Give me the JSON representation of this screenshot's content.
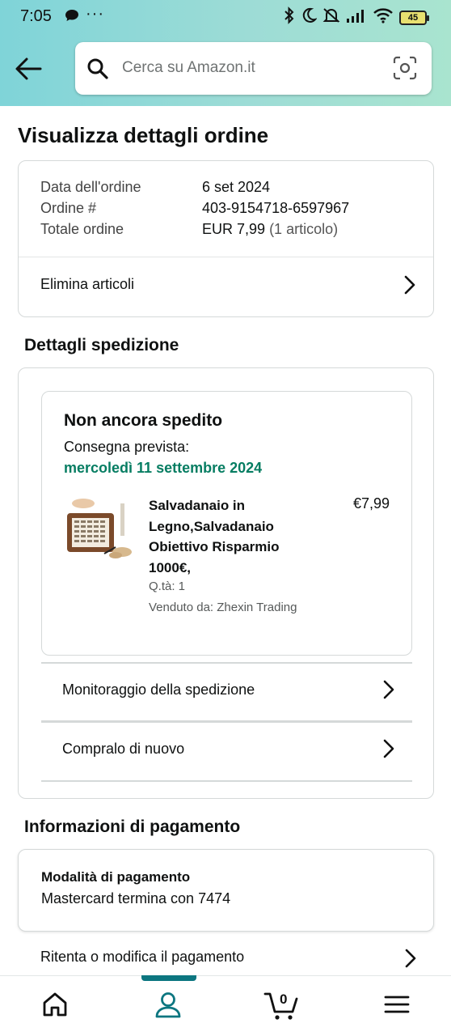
{
  "status_bar": {
    "time": "7:05",
    "dots": "···",
    "battery": "45"
  },
  "search": {
    "placeholder": "Cerca su Amazon.it"
  },
  "page": {
    "title": "Visualizza dettagli ordine"
  },
  "order_summary": {
    "rows": [
      {
        "label": "Data dell'ordine",
        "value": "6 set 2024"
      },
      {
        "label": "Ordine #",
        "value": "403-9154718-6597967"
      },
      {
        "label": "Totale ordine",
        "value": "EUR 7,99",
        "extra": "(1 articolo)"
      }
    ],
    "delete_items": "Elimina articoli"
  },
  "shipping": {
    "section_title": "Dettagli spedizione",
    "status": "Non ancora spedito",
    "delivery_label": "Consegna prevista:",
    "delivery_date": "mercoledì 11 settembre 2024",
    "item": {
      "name_lines": [
        "Salvadanaio in",
        "Legno,Salvadanaio",
        "Obiettivo Risparmio",
        "1000€,"
      ],
      "price": "€7,99",
      "qty": "Q.tà: 1",
      "seller": "Venduto da: Zhexin Trading"
    },
    "track_link": "Monitoraggio della spedizione",
    "buy_again_link": "Compralo di nuovo"
  },
  "payment": {
    "section_title": "Informazioni di pagamento",
    "method_title": "Modalità di pagamento",
    "method_value": "Mastercard  termina con 7474",
    "retry_link": "Ritenta o modifica il pagamento"
  },
  "bottom_nav": {
    "cart_count": "0",
    "active": "account"
  },
  "colors": {
    "accent": "#0c7680",
    "delivery_green": "#067d62",
    "header_gradient_start": "#7fd4d8",
    "header_gradient_end": "#a9e4cf"
  }
}
